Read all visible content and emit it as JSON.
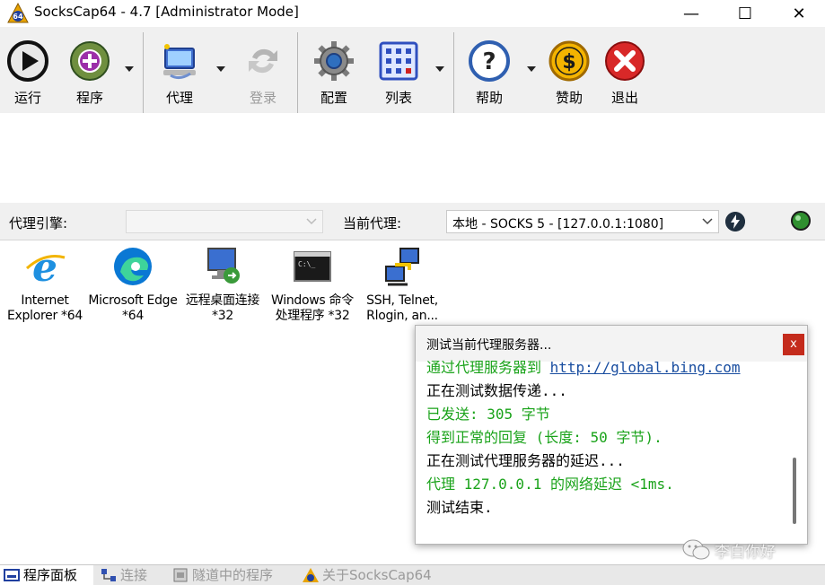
{
  "window": {
    "title": "SocksCap64 - 4.7 [Administrator Mode]",
    "logo_text": "64",
    "minimize_glyph": "—",
    "maximize_glyph": "☐",
    "close_glyph": "✕"
  },
  "toolbar": {
    "run": "运行",
    "programs": "程序",
    "proxy": "代理",
    "login": "登录",
    "config": "配置",
    "list": "列表",
    "help": "帮助",
    "donate": "赞助",
    "exit": "退出"
  },
  "proxybar": {
    "engine_label": "代理引擎:",
    "engine_value": "",
    "current_label": "当前代理:",
    "current_value": "本地 - SOCKS 5 - [127.0.0.1:1080]"
  },
  "programs": [
    {
      "name": "Internet Explorer *64",
      "icon": "internet-explorer-icon"
    },
    {
      "name": "Microsoft Edge *64",
      "icon": "edge-icon"
    },
    {
      "name": "远程桌面连接 *32",
      "icon": "remote-desktop-icon"
    },
    {
      "name": "Windows 命令处理程序 *32",
      "icon": "cmd-icon"
    },
    {
      "name": "SSH, Telnet, Rlogin, an...",
      "icon": "ssh-icon"
    }
  ],
  "popup": {
    "title": "测试当前代理服务器...",
    "close_glyph": "x",
    "log": [
      {
        "text": "通过代理服务器到 ",
        "url": "http://global.bing.com",
        "color": "green"
      },
      {
        "text": "正在测试数据传递...",
        "color": "black"
      },
      {
        "text": "已发送: 305 字节",
        "color": "green"
      },
      {
        "text": "得到正常的回复 (长度: 50 字节).",
        "color": "green"
      },
      {
        "text": "正在测试代理服务器的延迟...",
        "color": "black"
      },
      {
        "text": "代理 127.0.0.1 的网络延迟 <1ms.",
        "color": "green"
      },
      {
        "text": "测试结束.",
        "color": "black"
      }
    ]
  },
  "tabs": [
    {
      "label": "程序面板",
      "active": true
    },
    {
      "label": "连接",
      "active": false
    },
    {
      "label": "隧道中的程序",
      "active": false
    },
    {
      "label": "关于SocksCap64",
      "active": false
    }
  ],
  "watermark": {
    "text": "李白你好"
  },
  "colors": {
    "log_green": "#1aa31a",
    "log_url": "#1a4ea0",
    "close_red": "#c42b1c",
    "toolbar_bg": "#f0f0f0"
  }
}
